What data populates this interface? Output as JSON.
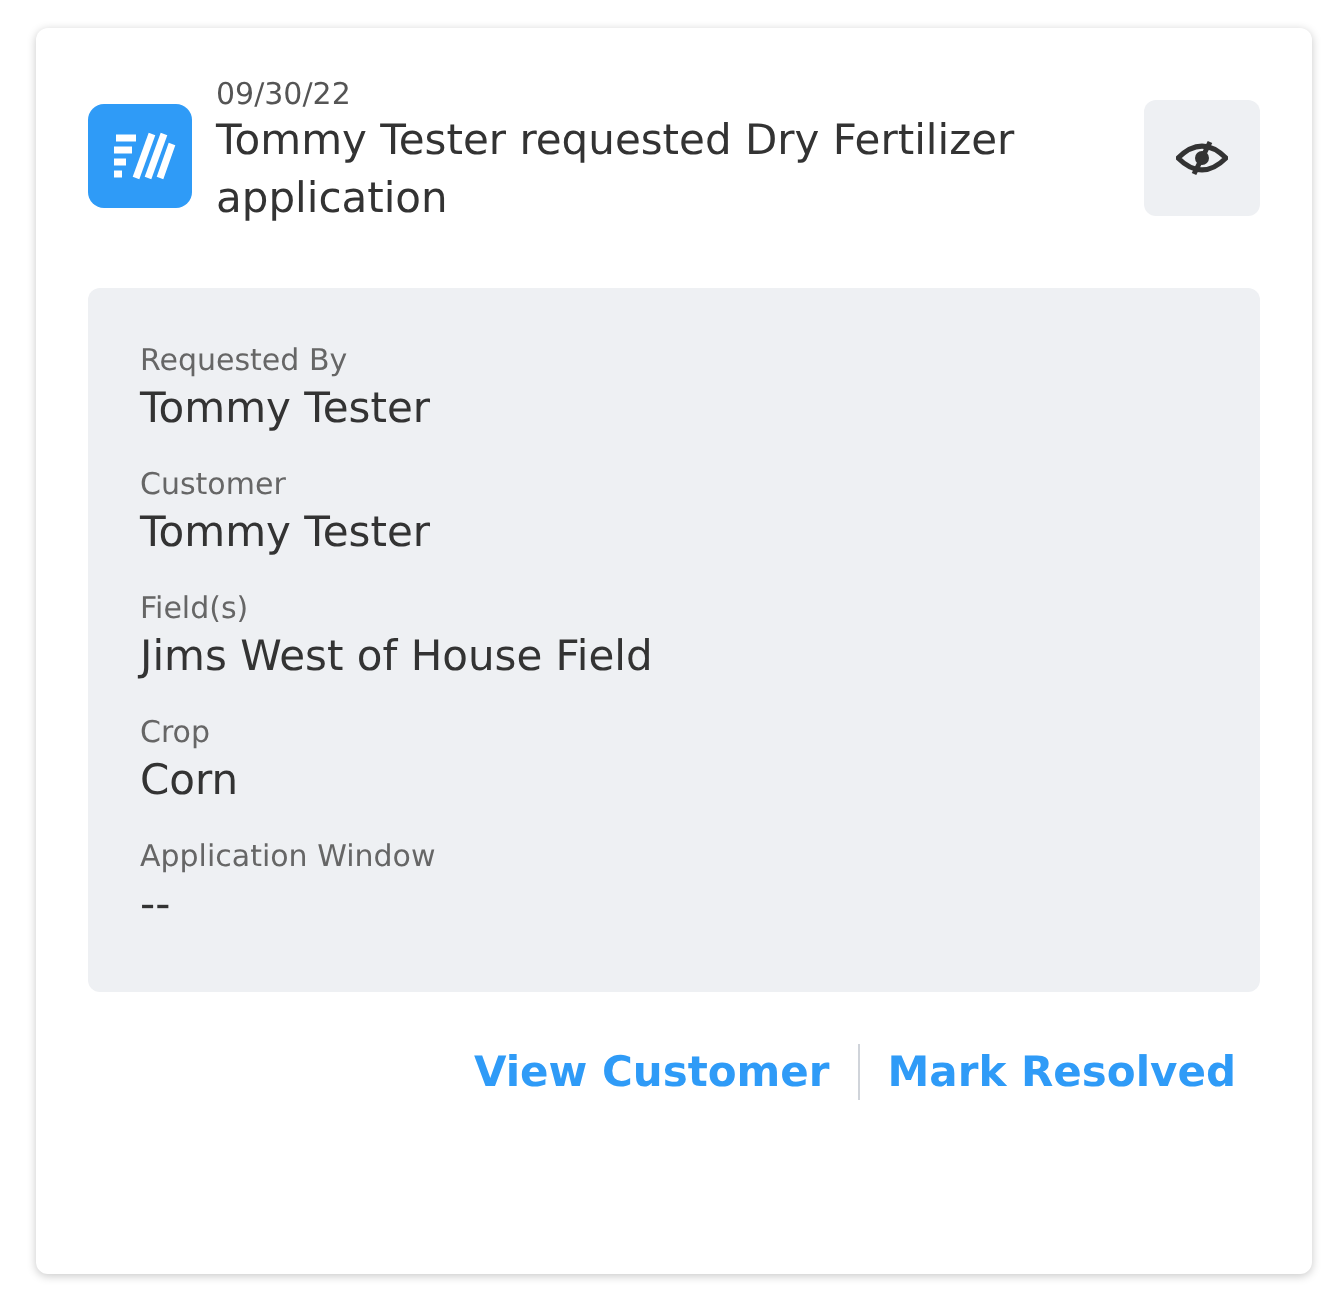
{
  "notification": {
    "date": "09/30/22",
    "title": "Tommy Tester requested Dry Fertilizer application",
    "details": [
      {
        "label": "Requested By",
        "value": "Tommy Tester"
      },
      {
        "label": "Customer",
        "value": "Tommy Tester"
      },
      {
        "label": "Field(s)",
        "value": "Jims West of House Field"
      },
      {
        "label": "Crop",
        "value": "Corn"
      },
      {
        "label": "Application Window",
        "value": "--"
      }
    ],
    "actions": [
      "View Customer",
      "Mark Resolved"
    ]
  }
}
